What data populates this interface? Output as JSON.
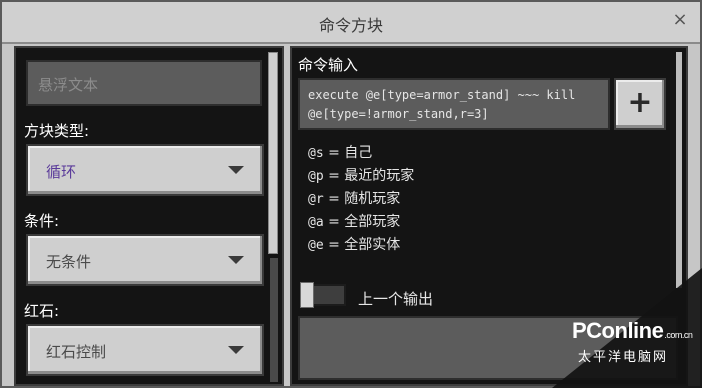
{
  "window": {
    "title": "命令方块",
    "close_glyph": "×"
  },
  "left": {
    "hover_placeholder": "悬浮文本",
    "block_type_label": "方块类型:",
    "block_type_value": "循环",
    "condition_label": "条件:",
    "condition_value": "无条件",
    "redstone_label": "红石:",
    "redstone_value": "红石控制"
  },
  "right": {
    "command_label": "命令输入",
    "command_line1": "execute @e[type=armor_stand] ~~~ kill",
    "command_line2": "@e[type=!armor_stand,r=3]",
    "add_glyph": "+",
    "help": [
      {
        "code": "@s",
        "desc": "= 自己"
      },
      {
        "code": "@p",
        "desc": "= 最近的玩家"
      },
      {
        "code": "@r",
        "desc": "= 随机玩家"
      },
      {
        "code": "@a",
        "desc": "= 全部玩家"
      },
      {
        "code": "@e",
        "desc": "= 全部实体"
      }
    ],
    "previous_output_label": "上一个输出",
    "previous_output_on": false
  },
  "watermark": {
    "brand": "PConline",
    "domain": ".com.cn",
    "sub": "太平洋电脑网"
  },
  "colors": {
    "panel_dark": "#141414",
    "button_gray": "#cfcfcf",
    "selected_text": "#5a3a9a"
  }
}
